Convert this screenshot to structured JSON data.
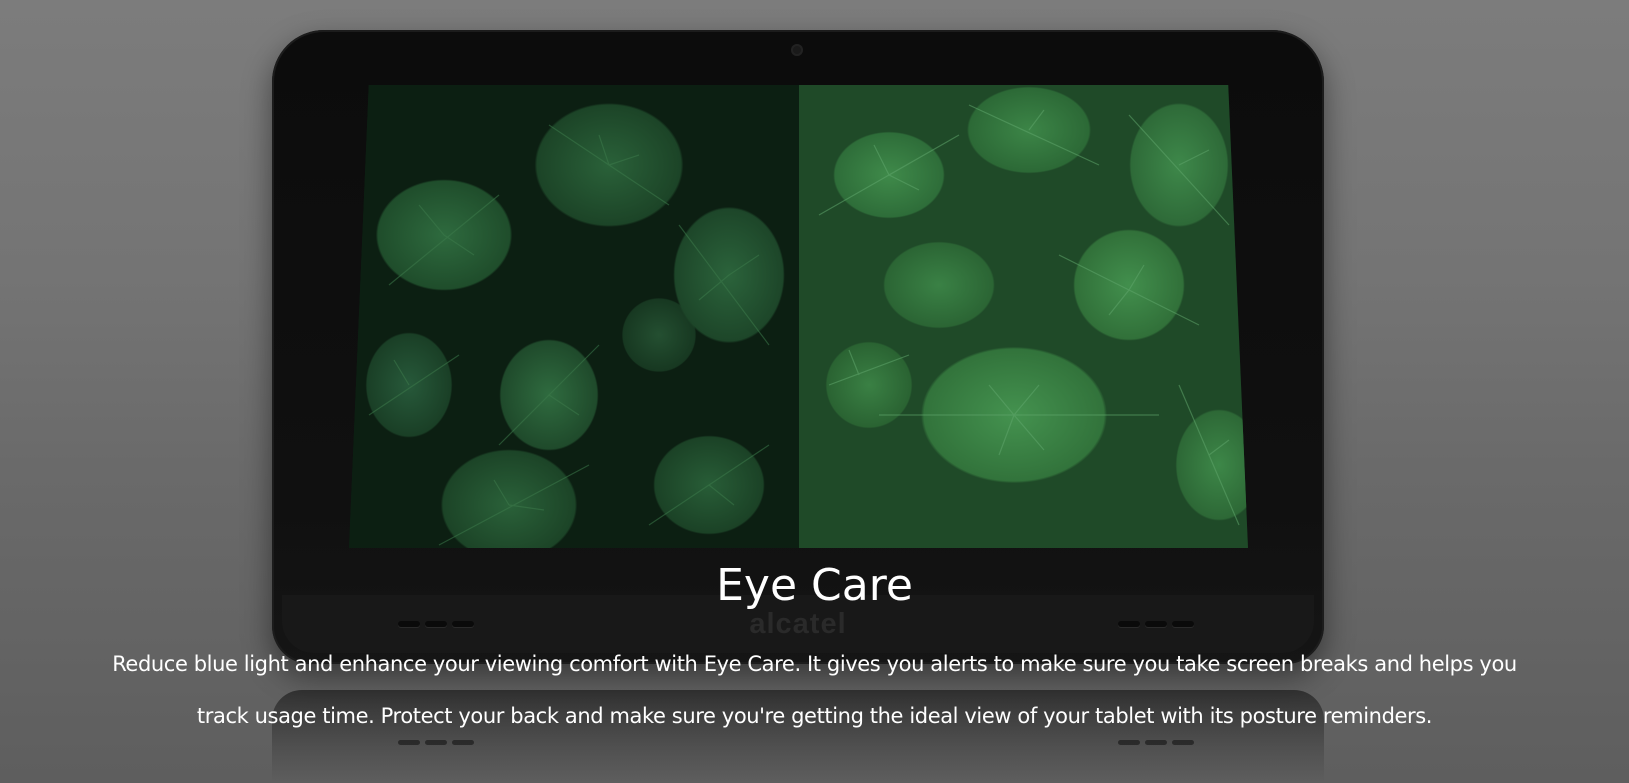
{
  "feature": {
    "title": "Eye Care",
    "description": "Reduce blue light and enhance your viewing comfort with Eye Care. It gives you alerts to make sure you take screen breaks and helps you track usage time. Protect your back and make sure you're getting the ideal view of your tablet with its posture reminders."
  },
  "device": {
    "brand": "alcatel",
    "screen_image": "leaves-comparison-image",
    "colors": {
      "body": "#0c0c0c",
      "leaves_dark": "#1c4427",
      "leaves_light": "#32733b"
    }
  }
}
